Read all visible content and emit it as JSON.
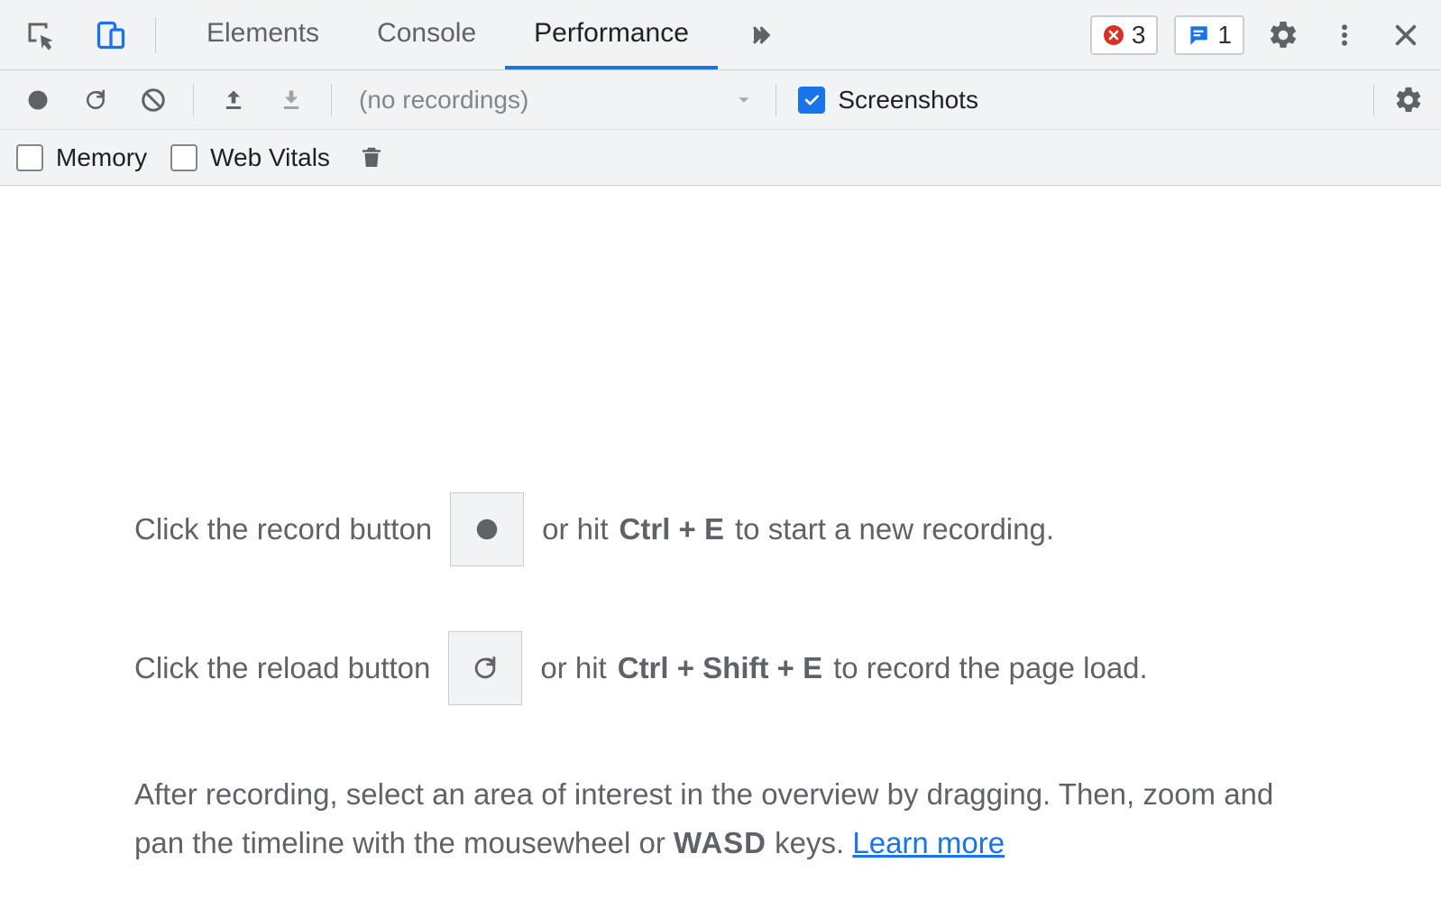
{
  "tabs": {
    "elements": "Elements",
    "console": "Console",
    "performance": "Performance"
  },
  "counters": {
    "errors": "3",
    "issues": "1"
  },
  "toolbar": {
    "no_recordings": "(no recordings)",
    "screenshots": "Screenshots",
    "memory": "Memory",
    "web_vitals": "Web Vitals"
  },
  "help": {
    "line1_pre": "Click the record button",
    "line1_mid": "or hit",
    "line1_key": "Ctrl + E",
    "line1_post": "to start a new recording.",
    "line2_pre": "Click the reload button",
    "line2_mid": "or hit",
    "line2_key": "Ctrl + Shift + E",
    "line2_post": "to record the page load.",
    "block_a": "After recording, select an area of interest in the overview by dragging. Then, zoom and pan the timeline with the mousewheel or ",
    "block_keys": "WASD",
    "block_b": " keys. ",
    "learn_more": "Learn more"
  }
}
